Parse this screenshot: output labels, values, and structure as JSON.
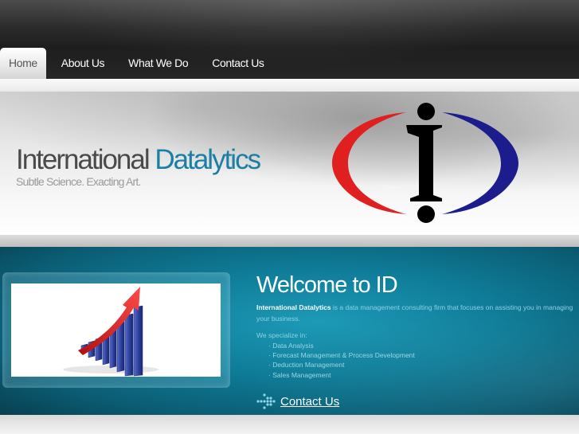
{
  "nav": {
    "items": [
      {
        "label": "Home"
      },
      {
        "label": "About Us"
      },
      {
        "label": "What We Do"
      },
      {
        "label": "Contact Us"
      }
    ],
    "active_index": 0
  },
  "banner": {
    "brand_part1": "International",
    "brand_part2": "Datalytics",
    "tagline": "Subtle Science. Exacting Art.",
    "logo_icon": "id-logo-icon",
    "colors": {
      "brand_accent": "#1b7fa5",
      "logo_red": "#e02020",
      "logo_blue": "#1c1c8c"
    }
  },
  "main": {
    "image_icon": "growth-chart-image",
    "welcome_title": "Welcome to ID",
    "intro_bold": "International Datalytics",
    "intro_text": " is a data management consulting firm that focuses on assisting you in managing your business.",
    "specialize_label": "We specialize in:",
    "services": [
      "· Data Analysis",
      "· Forecast Management & Process Development",
      "· Deduction Management",
      "· Sales Management"
    ],
    "contact_link": "Contact Us",
    "contact_icon": "dots-arrow-icon"
  }
}
